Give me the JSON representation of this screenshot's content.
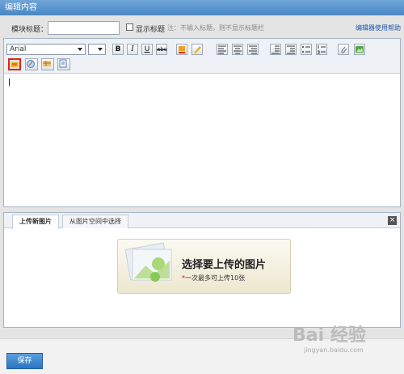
{
  "window": {
    "title": "编辑内容",
    "close_glyph": "×"
  },
  "title_row": {
    "label": "模块标题：",
    "input_value": "",
    "show_title_label": "显示标题",
    "note": "注：不输入标题，则不显示标题栏",
    "help_link": "编辑器使用帮助"
  },
  "toolbar": {
    "font_value": "Arial",
    "size_value": "",
    "bold": "B",
    "italic": "I",
    "underline": "U",
    "strike": "abc"
  },
  "upload": {
    "tabs": [
      {
        "label": "上传新图片",
        "active": true
      },
      {
        "label": "从图片空间中选择",
        "active": false
      }
    ],
    "close_glyph": "×",
    "button_title": "选择要上传的图片",
    "button_star": "*",
    "button_sub": "一次最多可上传10张"
  },
  "footer": {
    "save_label": "保存"
  },
  "watermark": {
    "text": "Bai 经验",
    "sub": "jingyan.baidu.com"
  },
  "colors": {
    "titlebar": "#4a86c4",
    "save": "#2a74c2",
    "highlight": "#e02020"
  }
}
